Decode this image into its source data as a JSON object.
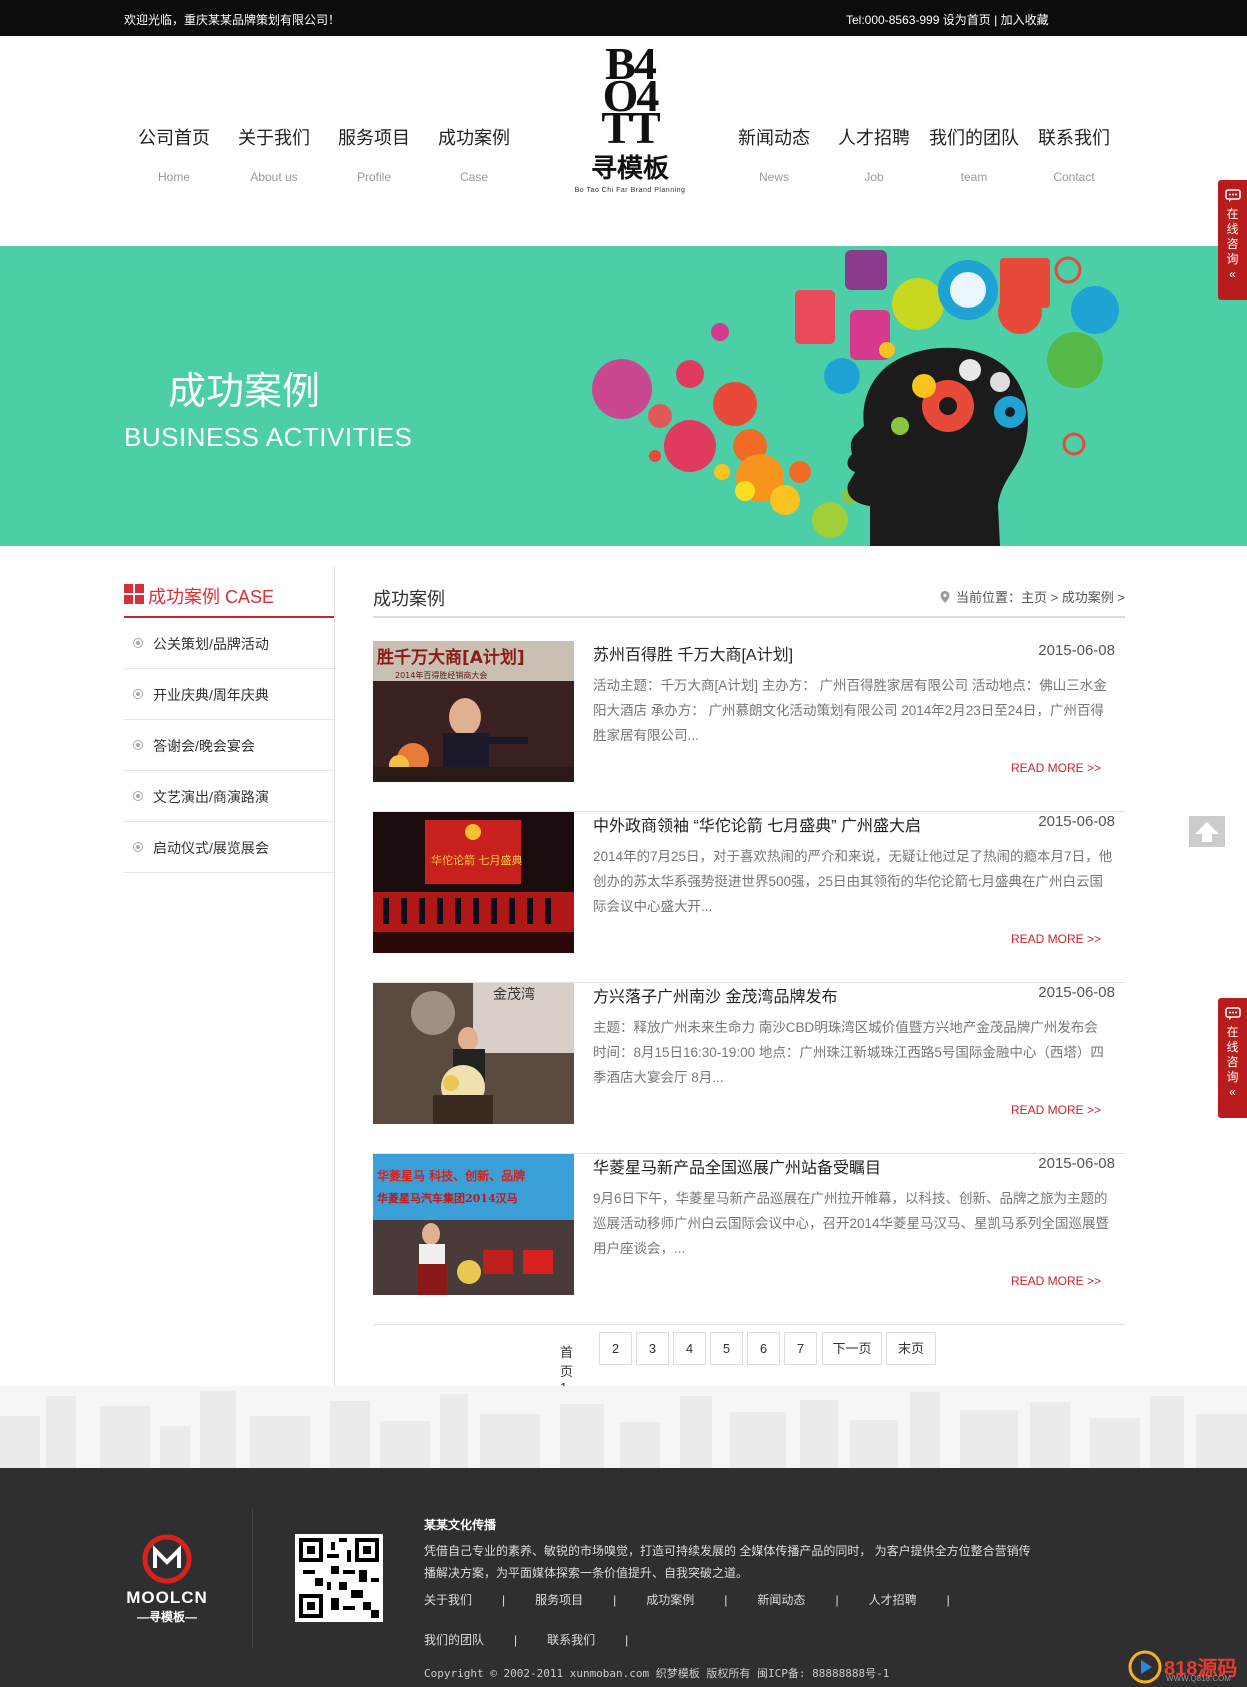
{
  "topbar": {
    "welcome": "欢迎光临，重庆某某品牌策划有限公司！",
    "tel": "Tel:000-8563-999",
    "set_home": "设为首页",
    "divider": "|",
    "add_fav": "加入收藏"
  },
  "nav_left": [
    {
      "cn": "公司首页",
      "en": "Home"
    },
    {
      "cn": "关于我们",
      "en": "About us"
    },
    {
      "cn": "服务项目",
      "en": "Profile"
    },
    {
      "cn": "成功案例",
      "en": "Case"
    }
  ],
  "nav_right": [
    {
      "cn": "新闻动态",
      "en": "News"
    },
    {
      "cn": "人才招聘",
      "en": "Job"
    },
    {
      "cn": "我们的团队",
      "en": "team"
    },
    {
      "cn": "联系我们",
      "en": "Contact"
    }
  ],
  "logo": {
    "mark_line1": "B4",
    "mark_line2": "O4",
    "mark_line3": "TT",
    "cn": "寻模板",
    "en": "Bo Tao Chi Far Brand Planning"
  },
  "banner": {
    "title": "成功案例",
    "subtitle": "BUSINESS ACTIVITIES",
    "bg_color": "#4ccfa6"
  },
  "sidebar": {
    "title": "成功案例 CASE",
    "items": [
      "公关策划/品牌活动",
      "开业庆典/周年庆典",
      "答谢会/晚会宴会",
      "文艺演出/商演路演",
      "启动仪式/展览展会"
    ]
  },
  "main": {
    "title": "成功案例",
    "breadcrumb": "当前位置：主页 > 成功案例 >",
    "read_more": "READ MORE >>",
    "cases": [
      {
        "title": "苏州百得胜 千万大商[A计划]",
        "date": "2015-06-08",
        "desc": "活动主题：千万大商[A计划] 主办方： 广州百得胜家居有限公司 活动地点：佛山三水金阳大酒店 承办方： 广州慕朗文化活动策划有限公司 2014年2月23日至24日，广州百得胜家居有限公司...",
        "thumb_text": "胜千万大商[A计划]",
        "thumb_sub": "2014年百得胜经销商大会"
      },
      {
        "title": "中外政商领袖 “华佗论箭 七月盛典” 广州盛大启",
        "date": "2015-06-08",
        "desc": "2014年的7月25日，对于喜欢热闹的严介和来说，无疑让他过足了热闹的瘾本月7日，他创办的苏太华系强势挺进世界500强，25日由其领衔的华佗论箭七月盛典在广州白云国际会议中心盛大开...",
        "thumb_text": "华佗论箭 七月盛典",
        "thumb_sub": ""
      },
      {
        "title": "方兴落子广州南沙 金茂湾品牌发布",
        "date": "2015-06-08",
        "desc": "主题：释放广州未来生命力 南沙CBD明珠湾区城价值暨方兴地产金茂品牌广州发布会 时间：8月15日16:30-19:00 地点：广州珠江新城珠江西路5号国际金融中心（西塔）四季酒店大宴会厅 8月...",
        "thumb_text": "金茂湾",
        "thumb_sub": ""
      },
      {
        "title": "华菱星马新产品全国巡展广州站备受瞩目",
        "date": "2015-06-08",
        "desc": "9月6日下午，华菱星马新产品巡展在广州拉开帷幕，以科技、创新、品牌之旅为主题的巡展活动移师广州白云国际会议中心，召开2014华菱星马汉马、星凯马系列全国巡展暨用户座谈会，...",
        "thumb_text": "华菱星马 科技、创新、品牌",
        "thumb_sub": "华菱星马汽车集团2014汉马"
      }
    ]
  },
  "pager": {
    "first": "首页",
    "current": "1",
    "pages": [
      "2",
      "3",
      "4",
      "5",
      "6",
      "7"
    ],
    "next": "下一页",
    "last": "末页"
  },
  "float": {
    "consult_chars": [
      "在",
      "线",
      "咨",
      "询"
    ],
    "chevron": "«"
  },
  "footer": {
    "brand": "MOOLCN",
    "brand_sub": "—寻模板—",
    "company": "某某文化传播",
    "intro": "凭借自己专业的素养、敏锐的市场嗅觉，打造可持续发展的 全媒体传播产品的同时， 为客户提供全方位整合营销传播解决方案，为平面媒体探索一条价值提升、自我突破之道。",
    "links": [
      "关于我们",
      "服务项目",
      "成功案例",
      "新闻动态",
      "人才招聘"
    ],
    "links2": [
      "我们的团队",
      "联系我们"
    ],
    "sep": "|",
    "copyright": "Copyright © 2002-2011 xunmoban.com 织梦模板 版权所有 闽ICP备: 88888888号-1",
    "watermark": "818源码",
    "watermark_url": "WWW.Q818.COM"
  },
  "colors": {
    "accent": "#c5252b",
    "banner": "#4ccfa6",
    "footer": "#2f2f31",
    "topbar": "#0c0c0c"
  }
}
